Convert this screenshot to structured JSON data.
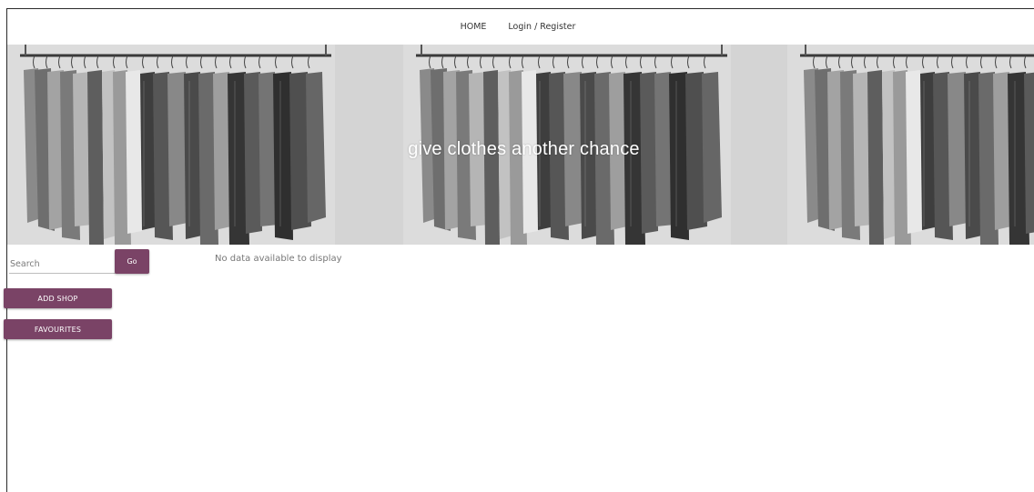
{
  "nav": {
    "home_label": "HOME",
    "login_label": "Login / Register"
  },
  "hero": {
    "tagline": "give clothes another chance"
  },
  "search": {
    "placeholder": "Search",
    "go_label": "Go"
  },
  "actions": {
    "add_shop_label": "ADD SHOP",
    "favourites_label": "FAVOURITES"
  },
  "content": {
    "empty_message": "No data available to display"
  },
  "colors": {
    "accent": "#7a4366"
  }
}
